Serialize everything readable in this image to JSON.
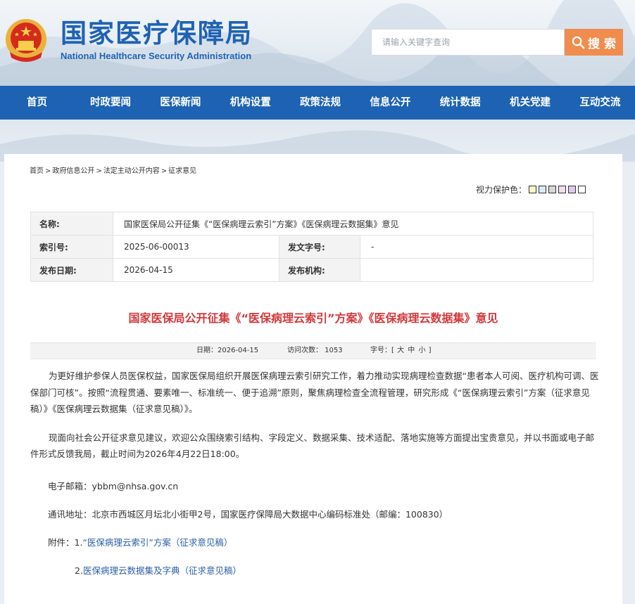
{
  "header": {
    "title": "国家医疗保障局",
    "subtitle": "National Healthcare Security Administration",
    "search_placeholder": "请输入关键字查询",
    "search_label": "搜 索"
  },
  "nav": {
    "items": [
      "首页",
      "时政要闻",
      "医保新闻",
      "机构设置",
      "政策法规",
      "信息公开",
      "统计数据",
      "机关党建",
      "互动交流"
    ]
  },
  "breadcrumb": {
    "items": [
      "首页",
      "政府信息公开",
      "法定主动公开内容",
      "征求意见"
    ],
    "separator": ">"
  },
  "eye_care": {
    "label": "视力保护色：",
    "colors": [
      "#fbf7c6",
      "#d3ecf7",
      "#d7d7d7",
      "#f2dde9",
      "#e2c8f0",
      "#ffffff"
    ]
  },
  "meta": {
    "name_label": "名称:",
    "name_value": "国家医保局公开征集《“医保病理云索引”方案》《医保病理云数据集》意见",
    "index_label": "索引号:",
    "index_value": "2025-06-00013",
    "doc_no_label": "发文字号:",
    "doc_no_value": "-",
    "date_label": "发布日期:",
    "date_value": "2026-04-15",
    "org_label": "发布机构:",
    "org_value": ""
  },
  "article": {
    "title": "国家医保局公开征集《“医保病理云索引”方案》《医保病理云数据集》意见",
    "date": "日期：2026-04-15",
    "views": "访问次数：  1053",
    "font_size_label": "字号：[",
    "font_size_options": [
      "大",
      "中",
      "小"
    ],
    "font_size_end": "]",
    "paragraphs": [
      "为更好维护参保人员医保权益，国家医保局组织开展医保病理云索引研究工作，着力推动实现病理检查数据“患者本人可阅、医疗机构可调、医保部门可核”。按照“流程贯通、要素唯一、标准统一、便于追溯”原则，聚焦病理检查全流程管理，研究形成《“医保病理云索引”方案（征求意见稿）》《医保病理云数据集（征求意见稿）》。",
      "现面向社会公开征求意见建议，欢迎公众围绕索引结构、字段定义、数据采集、技术适配、落地实施等方面提出宝贵意见，并以书面或电子邮件形式反馈我局，截止时间为2026年4月22日18:00。"
    ],
    "email_line": "电子邮箱：ybbm@nhsa.gov.cn",
    "address_line": "通讯地址：北京市西城区月坛北小街甲2号，国家医疗保障局大数据中心编码标准处（邮编：100830）",
    "attachments_label": "附件：1.",
    "attachment1": "“医保病理云索引”方案（征求意见稿）",
    "attachment2_prefix": "2.",
    "attachment2": "医保病理云数据集及字典（征求意见稿）"
  }
}
